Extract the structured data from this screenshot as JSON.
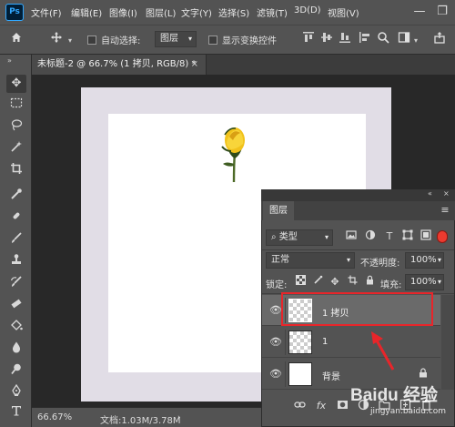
{
  "menu": {
    "logo": "Ps",
    "items": [
      "文件(F)",
      "编辑(E)",
      "图像(I)",
      "图层(L)",
      "文字(Y)",
      "选择(S)",
      "滤镜(T)",
      "3D(D)",
      "视图(V)"
    ],
    "minimize": "—",
    "restore": "❐"
  },
  "options": {
    "home_icon": "home-icon",
    "move_icon": "move-icon",
    "auto_select_label": "自动选择:",
    "auto_select_value": "图层",
    "show_transform_label": "显示变换控件",
    "auto_select_checked": false,
    "show_transform_checked": false
  },
  "document": {
    "tab_label": "未标题-2 @ 66.7% (1 拷贝, RGB/8) *",
    "tab_close": "×"
  },
  "status": {
    "zoom": "66.67%",
    "doc_size": "文档:1.03M/3.78M"
  },
  "layers_panel": {
    "title": "图层",
    "filter_value": "类型",
    "blend_mode": "正常",
    "opacity_label": "不透明度:",
    "opacity_value": "100%",
    "lock_label": "锁定:",
    "fill_label": "填充:",
    "fill_value": "100%",
    "layers": [
      {
        "name": "1 拷贝",
        "selected": true,
        "visible": true,
        "locked": false
      },
      {
        "name": "1",
        "selected": false,
        "visible": true,
        "locked": false
      },
      {
        "name": "背景",
        "selected": false,
        "visible": true,
        "locked": true
      }
    ],
    "footer_fx": "fx"
  },
  "watermark": {
    "brand": "Baidu 经验",
    "url": "jingyan.baidu.com"
  },
  "colors": {
    "highlight": "#e8252a",
    "arrow": "#e8252a",
    "ps_blue": "#31a8ff"
  }
}
